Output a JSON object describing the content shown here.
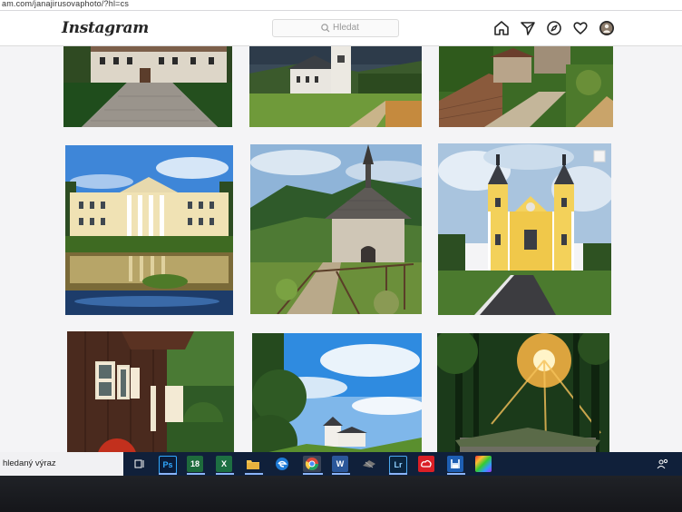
{
  "browser": {
    "url": "am.com/janajirusovaphoto/?hl=cs"
  },
  "header": {
    "logo": "Instagram",
    "search_placeholder": "Hledat",
    "nav_icons": [
      "home-icon",
      "direct-message-icon",
      "explore-compass-icon",
      "activity-heart-icon",
      "profile-avatar-icon"
    ]
  },
  "grid": {
    "columns": 3,
    "rows": 3,
    "posts": [
      {
        "subject": "château with tree-lined cobblestone avenue"
      },
      {
        "subject": "white church with tower in green meadow"
      },
      {
        "subject": "castle ruins on hilltop, aerial view"
      },
      {
        "subject": "yellow classicist château reflected in pond"
      },
      {
        "subject": "round chapel with shingled roof on hill"
      },
      {
        "subject": "yellow baroque pilgrimage church with two towers"
      },
      {
        "subject": "wooden cottage with red flowers"
      },
      {
        "subject": "small church among trees under blue sky"
      },
      {
        "subject": "concrete bunker in forest with sun rays"
      }
    ]
  },
  "taskbar": {
    "search_text": "hledaný výraz",
    "apps": [
      {
        "name": "task-view",
        "label": ""
      },
      {
        "name": "photoshop",
        "label": "Ps",
        "color": "#0a1c3a"
      },
      {
        "name": "calendar-18",
        "label": "18",
        "color": "#1e6b3c"
      },
      {
        "name": "excel",
        "label": "X",
        "color": "#1d6f42"
      },
      {
        "name": "file-explorer",
        "label": "",
        "color": "#f2c14e"
      },
      {
        "name": "edge",
        "label": "e",
        "color": "#1f7bd6"
      },
      {
        "name": "chrome",
        "label": "",
        "color": "#dd4b39"
      },
      {
        "name": "word",
        "label": "W",
        "color": "#2b579a"
      },
      {
        "name": "tool",
        "label": "",
        "color": "#3b3b3b"
      },
      {
        "name": "lightroom",
        "label": "Lr",
        "color": "#0a2540"
      },
      {
        "name": "creative-cloud",
        "label": "",
        "color": "#da1f26"
      },
      {
        "name": "save-app",
        "label": "",
        "color": "#1e5fb4"
      },
      {
        "name": "color-app",
        "label": "",
        "color": "#7a3db8"
      }
    ]
  }
}
